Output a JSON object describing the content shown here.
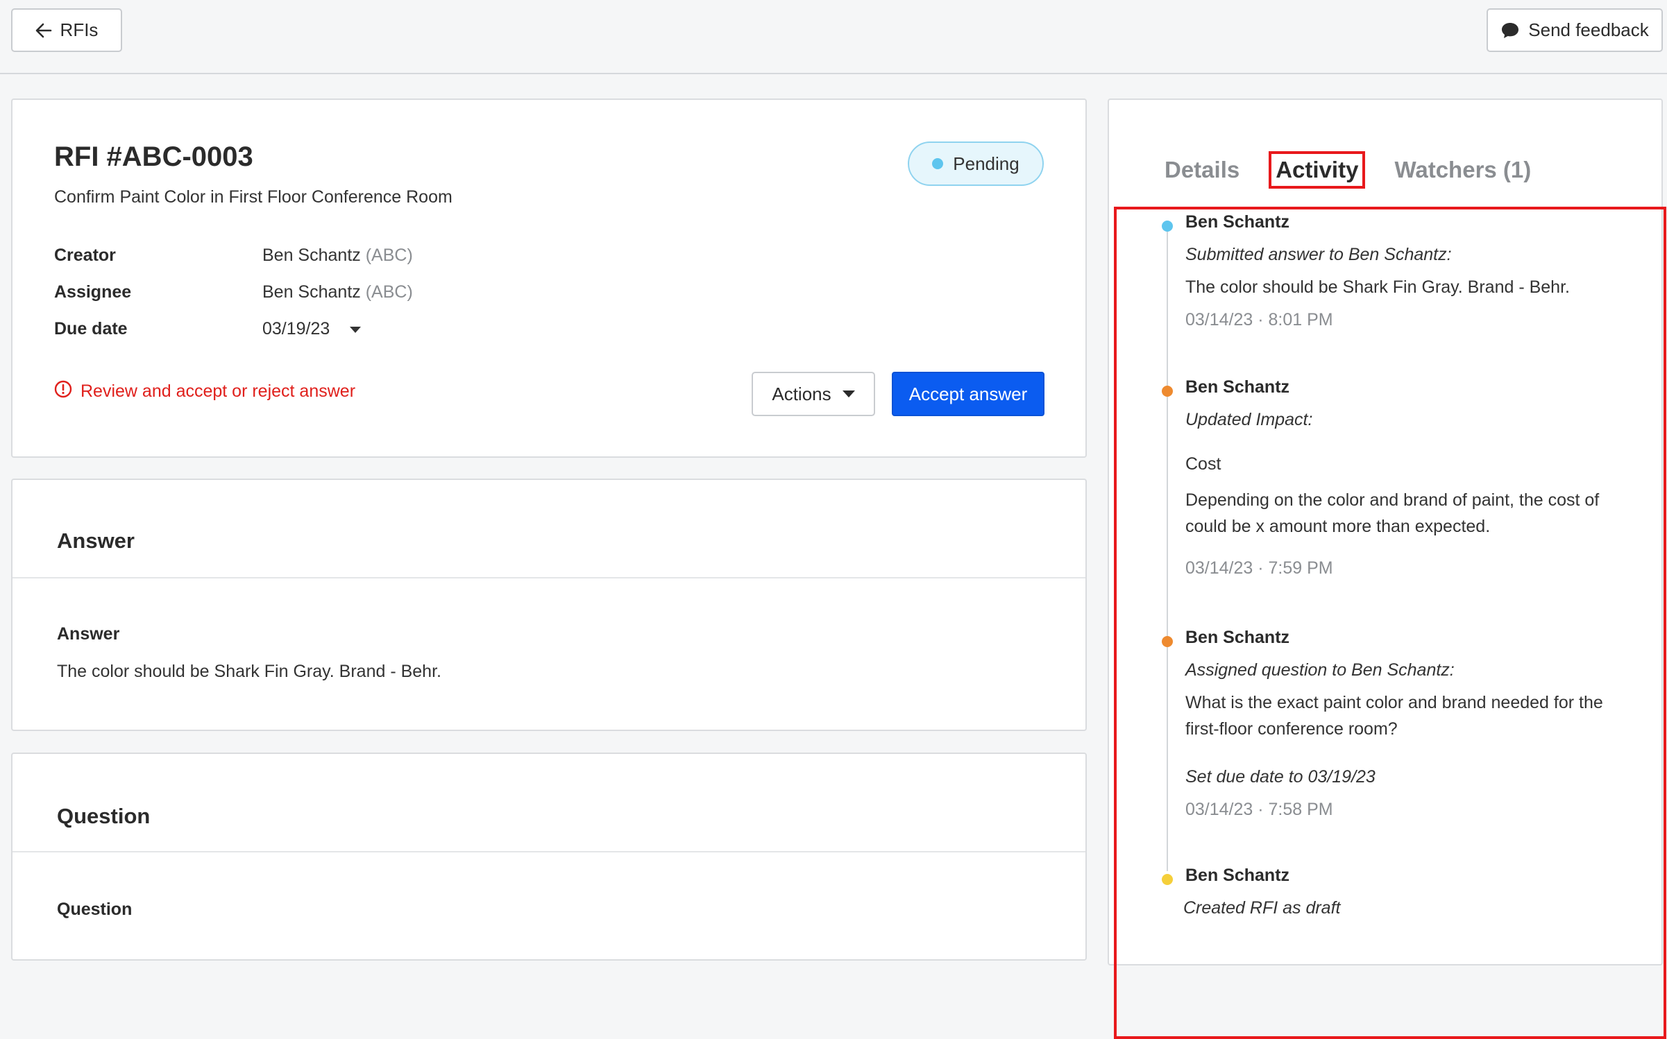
{
  "topbar": {
    "back_label": "RFIs",
    "feedback_label": "Send feedback"
  },
  "rfi": {
    "title": "RFI #ABC-0003",
    "subtitle": "Confirm Paint Color in First Floor Conference Room",
    "status": "Pending",
    "status_color": "#5ec5ee",
    "creator_label": "Creator",
    "creator_name": "Ben Schantz",
    "creator_org": "(ABC)",
    "assignee_label": "Assignee",
    "assignee_name": "Ben Schantz",
    "assignee_org": "(ABC)",
    "due_label": "Due date",
    "due_value": "03/19/23",
    "warning": "Review and accept or reject answer",
    "actions_label": "Actions",
    "accept_label": "Accept answer"
  },
  "answer_section": {
    "heading": "Answer",
    "field_label": "Answer",
    "field_value": "The color should be Shark Fin Gray. Brand - Behr."
  },
  "question_section": {
    "heading": "Question",
    "field_label": "Question"
  },
  "sidebar": {
    "tabs": [
      {
        "label": "Details"
      },
      {
        "label": "Activity"
      },
      {
        "label": "Watchers (1)"
      }
    ],
    "activity": [
      {
        "name": "Ben Schantz",
        "dot_color": "#5ec5ee",
        "action": "Submitted answer to Ben Schantz:",
        "body": "The color should be Shark Fin Gray. Brand - Behr.",
        "time": "03/14/23 · 8:01 PM"
      },
      {
        "name": "Ben Schantz",
        "dot_color": "#ee8a2f",
        "action": "Updated Impact:",
        "impact": "Cost",
        "body": "Depending on the color and brand of paint, the cost of could be x amount more than expected.",
        "time": "03/14/23 · 7:59 PM"
      },
      {
        "name": "Ben Schantz",
        "dot_color": "#ee8a2f",
        "action": "Assigned question to Ben Schantz:",
        "body": "What is the exact paint color and brand needed for the first-floor conference room?",
        "extra": "Set due date to 03/19/23",
        "time": "03/14/23 · 7:58 PM"
      },
      {
        "name": "Ben Schantz",
        "dot_color": "#f5cf3a",
        "action": "Created RFI as draft"
      }
    ]
  },
  "colors": {
    "accent": "#0b5cf0",
    "warning": "#e0201c",
    "highlight": "#e8191c"
  }
}
